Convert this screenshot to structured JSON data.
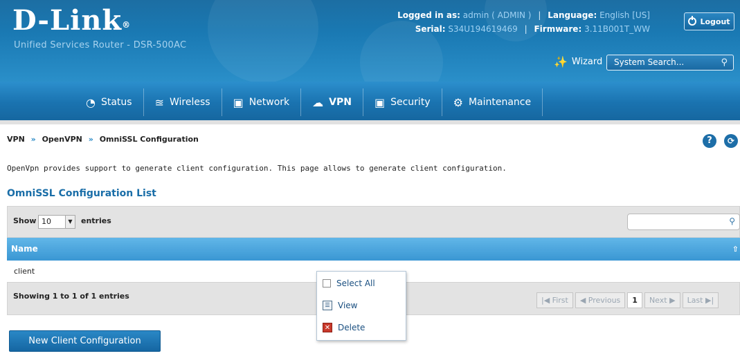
{
  "header": {
    "logo": "D-Link",
    "logo_mark": "®",
    "product": "Unified Services Router - DSR-500AC",
    "logged_in_label": "Logged in as:",
    "logged_in_value": "admin ( ADMIN )",
    "language_label": "Language:",
    "language_value": "English [US]",
    "serial_label": "Serial:",
    "serial_value": "S34U194619469",
    "firmware_label": "Firmware:",
    "firmware_value": "3.11B001T_WW",
    "logout_label": "Logout",
    "wizard_label": "Wizard",
    "search_placeholder": "System Search..."
  },
  "nav": {
    "items": [
      {
        "label": "Status",
        "icon": "gauge-icon"
      },
      {
        "label": "Wireless",
        "icon": "wifi-icon"
      },
      {
        "label": "Network",
        "icon": "monitor-icon"
      },
      {
        "label": "VPN",
        "icon": "vpn-cloud-icon",
        "active": true
      },
      {
        "label": "Security",
        "icon": "lock-icon"
      },
      {
        "label": "Maintenance",
        "icon": "gears-icon"
      }
    ]
  },
  "breadcrumb": {
    "items": [
      "VPN",
      "OpenVPN",
      "OmniSSL Configuration"
    ],
    "separator": "»"
  },
  "page": {
    "description": "OpenVpn provides support to generate client configuration. This page allows to generate client configuration.",
    "list_title": "OmniSSL Configuration List"
  },
  "table": {
    "show_label": "Show",
    "entries_value": "10",
    "entries_label": "entries",
    "column_name": "Name",
    "rows": [
      {
        "name": "client"
      }
    ],
    "info": "Showing 1 to 1 of 1 entries",
    "pager": {
      "first": "First",
      "previous": "Previous",
      "current": "1",
      "next": "Next",
      "last": "Last"
    }
  },
  "context_menu": {
    "select_all": "Select All",
    "view": "View",
    "delete": "Delete"
  },
  "actions": {
    "new_client": "New Client Configuration"
  },
  "colors": {
    "header_blue": "#1a79b3",
    "accent_blue": "#1a6ea8",
    "table_header": "#3a97d3",
    "delete_red": "#c8392b"
  }
}
